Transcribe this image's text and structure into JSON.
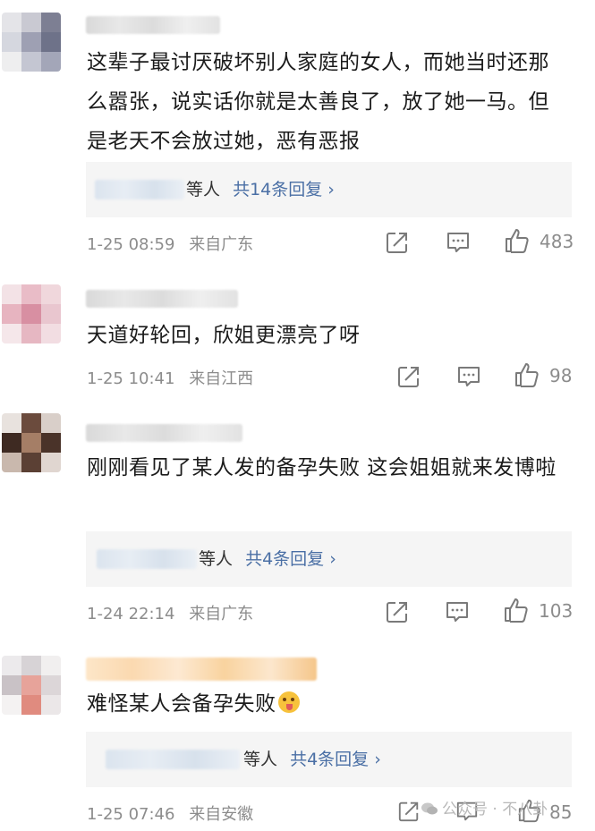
{
  "comments": [
    {
      "text": "这辈子最讨厌破坏别人家庭的女人，而她当时还那么嚣张，说实话你就是太善良了，放了她一马。但是老天不会放过她，恶有恶报",
      "reply_suffix": "等人",
      "reply_link": "共14条回复 ›",
      "time": "1-25 08:59",
      "location": "来自广东",
      "likes": "483"
    },
    {
      "text": "天道好轮回，欣姐更漂亮了呀",
      "time": "1-25 10:41",
      "location": "来自江西",
      "likes": "98"
    },
    {
      "text": "刚刚看见了某人发的备孕失败 这会姐姐就来发博啦",
      "reply_suffix": "等人",
      "reply_link": "共4条回复 ›",
      "time": "1-24 22:14",
      "location": "来自广东",
      "likes": "103"
    },
    {
      "text": "难怪某人会备孕失败",
      "emoji": "tongue-out-emoji",
      "reply_suffix": "等人",
      "reply_link": "共4条回复 ›",
      "time": "1-25 07:46",
      "location": "来自安徽",
      "likes": "85"
    }
  ],
  "watermark": "公众号 · 不八卦",
  "icons": {
    "share": "share-icon",
    "comment": "comment-icon",
    "like": "thumbs-up-icon",
    "watermark_logo": "wechat-logo-icon"
  },
  "colors": {
    "link": "#4a6fa5",
    "meta": "#8c8c8c",
    "reply_bg": "#f5f5f5"
  }
}
